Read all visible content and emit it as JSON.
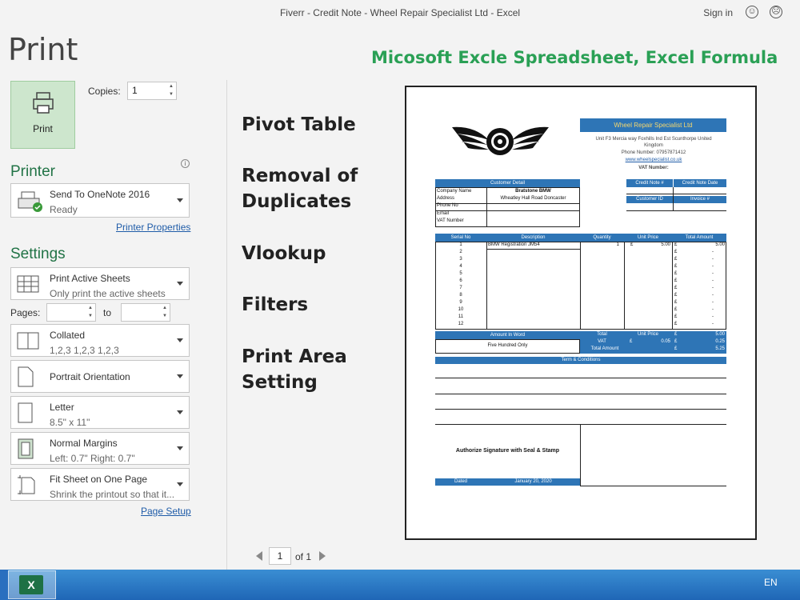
{
  "window": {
    "title": "Fiverr - Credit Note - Wheel Repair Specialist Ltd  -  Excel",
    "signin": "Sign in",
    "smile_icon": "smile-icon",
    "frown_icon": "frown-icon"
  },
  "left": {
    "heading": "Print",
    "print_button": "Print",
    "copies_label": "Copies:",
    "copies_value": "1",
    "printer_heading": "Printer",
    "printer_name": "Send To OneNote 2016",
    "printer_status": "Ready",
    "printer_properties": "Printer Properties",
    "settings_heading": "Settings",
    "settings": [
      {
        "t1": "Print Active Sheets",
        "t2": "Only print the active sheets"
      },
      {
        "t1": "Collated",
        "t2": "1,2,3    1,2,3    1,2,3"
      },
      {
        "t1": "Portrait Orientation",
        "t2": ""
      },
      {
        "t1": "Letter",
        "t2": "8.5\" x 11\""
      },
      {
        "t1": "Normal Margins",
        "t2": "Left:  0.7\"    Right:  0.7\""
      },
      {
        "t1": "Fit Sheet on One Page",
        "t2": "Shrink the printout so that it..."
      }
    ],
    "pages_label": "Pages:",
    "to_label": "to",
    "page_setup": "Page Setup"
  },
  "features": [
    "Pivot Table",
    "Removal of",
    "Duplicates",
    "Vlookup",
    "Filters",
    "Print Area",
    "Setting"
  ],
  "headline": "Micosoft Excle Spreadsheet, Excel Formula",
  "doc": {
    "company": "Wheel Repair Specialist Ltd",
    "addr1": "Unit F3 Mercia way Foxhills Ind Est Scunthorpe United",
    "addr2": "Kingdom",
    "phone": "Phone Number: 07957871412",
    "website": "www.wheelspecialist.co.uk",
    "vat": "VAT Number:",
    "customer_detail": "Customer Detail",
    "company_name_label": "Company Name",
    "company_name": "Bratstone BMW",
    "address_label": "Address",
    "address": "Wheatley Hall Road Doncaster",
    "phone_label": "Phone No",
    "email_label": "Email",
    "vat_label": "VAT Number",
    "credit_note_no": "Credit Note #",
    "credit_note_date": "Credit Note Date",
    "customer_id": "Customer ID",
    "invoice_no": "Invoice #",
    "cols": [
      "Serial No",
      "Description",
      "Quantity",
      "Unit Price",
      "Total Amount"
    ],
    "row1": {
      "desc": "BMW Registration JM54",
      "qty": "1",
      "cur": "£",
      "price": "5.00",
      "total": "5.00"
    },
    "serials": [
      "1",
      "2",
      "3",
      "4",
      "5",
      "6",
      "7",
      "8",
      "9",
      "10",
      "11",
      "12"
    ],
    "pound": "£",
    "dash": "-",
    "amount_in_word": "Amount In Word",
    "amount_words": "Five Hundred Only",
    "total_label": "Total",
    "unit_price_label": "Unit Price",
    "vat_row": "VAT",
    "vat_rate": "0.05",
    "total_amount_label": "Total Amount",
    "sum_total": "5.00",
    "sum_vat": "0.25",
    "sum_grand": "5.25",
    "terms": "Term & Conditions",
    "signature": "Authorize Signature with Seal & Stamp",
    "dated_label": "Dated",
    "dated_value": "January 20, 2020"
  },
  "nav": {
    "page": "1",
    "of": "of 1"
  },
  "taskbar": {
    "lang": "EN",
    "excel": "X"
  }
}
